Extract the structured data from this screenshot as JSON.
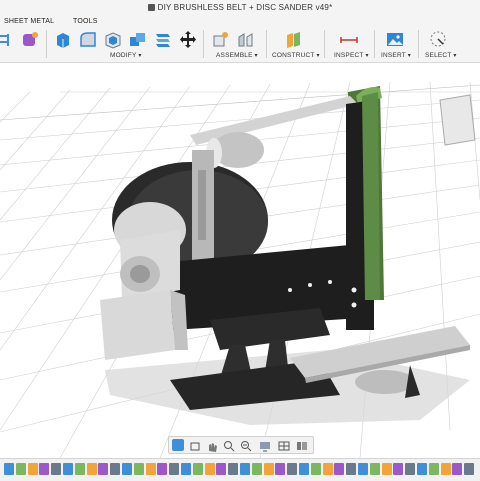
{
  "app": {
    "document_title": "DIY BRUSHLESS BELT + DISC SANDER v49*"
  },
  "ribbon": {
    "tabs": [
      {
        "label": "SHEET METAL"
      },
      {
        "label": "TOOLS"
      }
    ],
    "groups": [
      {
        "label": "MODIFY"
      },
      {
        "label": "ASSEMBLE"
      },
      {
        "label": "CONSTRUCT"
      },
      {
        "label": "INSPECT"
      },
      {
        "label": "INSERT"
      },
      {
        "label": "SELECT"
      }
    ],
    "tools": [
      {
        "icon": "sketch-icon"
      },
      {
        "icon": "form-icon"
      },
      {
        "icon": "press-pull-icon"
      },
      {
        "icon": "fillet-icon"
      },
      {
        "icon": "shell-icon"
      },
      {
        "icon": "combine-icon"
      },
      {
        "icon": "align-icon"
      },
      {
        "icon": "move-icon"
      },
      {
        "icon": "new-component-icon"
      },
      {
        "icon": "joint-icon"
      },
      {
        "icon": "offset-plane-icon"
      },
      {
        "icon": "measure-icon"
      },
      {
        "icon": "insert-image-icon"
      },
      {
        "icon": "select-icon"
      }
    ]
  },
  "navbar": {
    "tools": [
      {
        "icon": "orbit-icon"
      },
      {
        "icon": "look-at-icon"
      },
      {
        "icon": "pan-icon"
      },
      {
        "icon": "zoom-icon"
      },
      {
        "icon": "fit-icon"
      },
      {
        "icon": "display-settings-icon"
      },
      {
        "icon": "grid-settings-icon"
      },
      {
        "icon": "viewports-icon"
      }
    ]
  },
  "timeline": {
    "feature_count": 40
  },
  "colors": {
    "belt": "#4d7838",
    "arm": "#1e1e1e",
    "housing": "#d9d9d9",
    "steel": "#b8b8b8",
    "grid": "#c9c9c9",
    "accent": "#3e8ed8"
  }
}
